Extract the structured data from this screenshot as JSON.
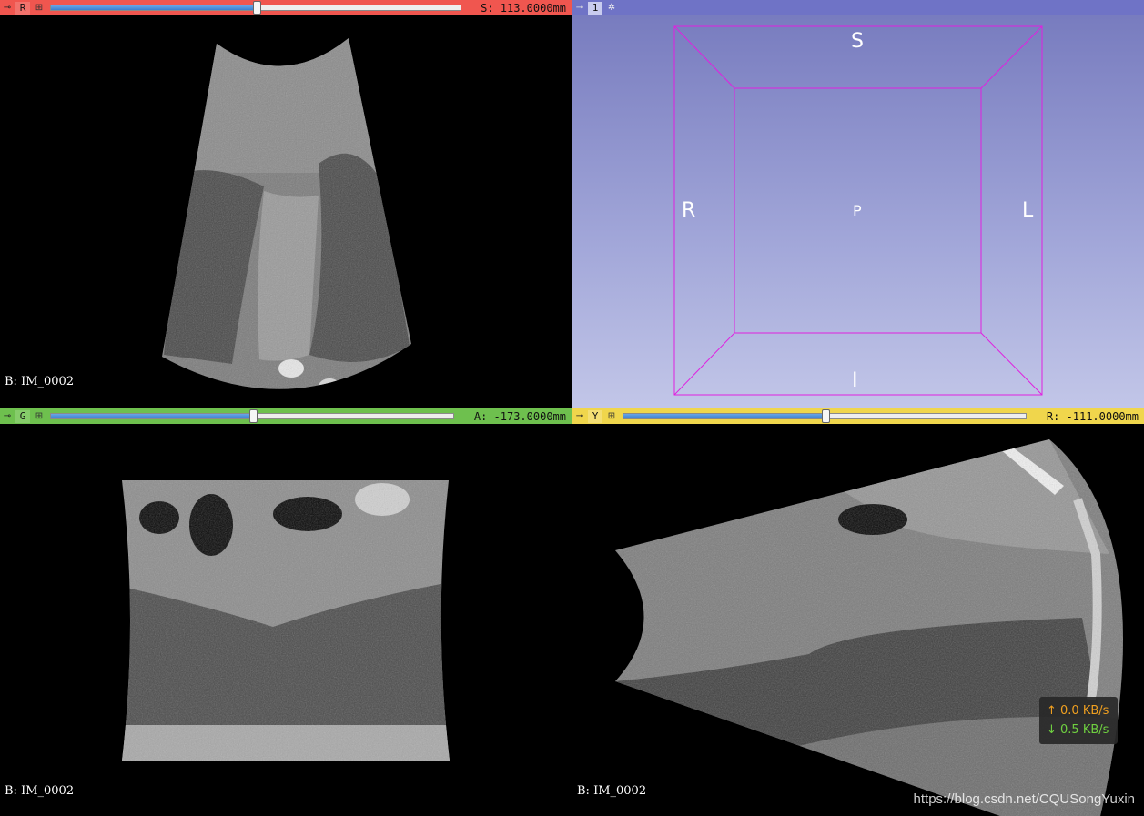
{
  "views": {
    "red": {
      "letter": "R",
      "offset": "S: 113.0000mm",
      "slider_value": 0.5,
      "background_label": "B: IM_0002",
      "color": "#f0564f"
    },
    "threeD": {
      "letter": "1",
      "labels": {
        "top": "S",
        "bottom": "I",
        "left": "R",
        "right": "L",
        "center": "P"
      },
      "box_color": "#e020e0"
    },
    "green": {
      "letter": "G",
      "offset": "A: -173.0000mm",
      "slider_value": 0.5,
      "background_label": "B: IM_0002",
      "color": "#6ec04e"
    },
    "yellow": {
      "letter": "Y",
      "offset": "R: -111.0000mm",
      "slider_value": 0.5,
      "background_label": "B: IM_0002",
      "color": "#f0d64c"
    }
  },
  "network": {
    "upload": "↑ 0.0 KB/s",
    "download": "↓ 0.5 KB/s"
  },
  "watermark": "https://blog.csdn.net/CQUSongYuxin",
  "icons": {
    "pin": "pin-icon",
    "link": "link-icon",
    "settings": "gear-icon"
  }
}
